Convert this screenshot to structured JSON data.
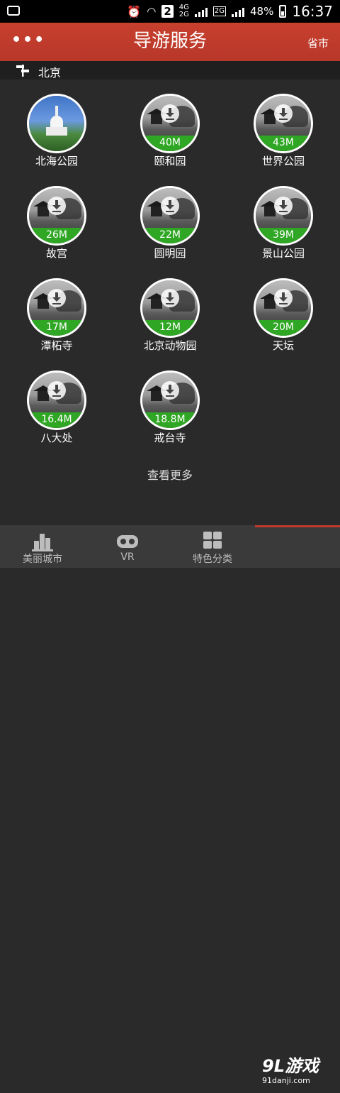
{
  "status_bar": {
    "sim_badge": "2",
    "net_4g": "4G",
    "net_2g": "2G",
    "net_2g_box": "2G",
    "battery": "48%",
    "time": "16:37"
  },
  "header": {
    "menu_glyph": "•••",
    "title": "导游服务",
    "right_label": "省市"
  },
  "city": {
    "name": "北京",
    "icon": "signpost-icon"
  },
  "spots": [
    {
      "name": "北海公园",
      "size": "",
      "downloaded": true
    },
    {
      "name": "颐和园",
      "size": "40M",
      "downloaded": false
    },
    {
      "name": "世界公园",
      "size": "43M",
      "downloaded": false
    },
    {
      "name": "故宫",
      "size": "26M",
      "downloaded": false
    },
    {
      "name": "圆明园",
      "size": "22M",
      "downloaded": false
    },
    {
      "name": "景山公园",
      "size": "39M",
      "downloaded": false
    },
    {
      "name": "潭柘寺",
      "size": "17M",
      "downloaded": false
    },
    {
      "name": "北京动物园",
      "size": "12M",
      "downloaded": false
    },
    {
      "name": "天坛",
      "size": "20M",
      "downloaded": false
    },
    {
      "name": "八大处",
      "size": "16.4M",
      "downloaded": false
    },
    {
      "name": "戒台寺",
      "size": "18.8M",
      "downloaded": false
    }
  ],
  "more_label": "查看更多",
  "tabs": [
    {
      "label": "美丽城市",
      "icon": "city-icon"
    },
    {
      "label": "VR",
      "icon": "vr-goggles-icon"
    },
    {
      "label": "特色分类",
      "icon": "category-grid-icon"
    }
  ],
  "watermark": {
    "logo": "9L游戏",
    "site": "91danji.com"
  },
  "colors": {
    "header": "#c0392b",
    "size_bar": "#2fa624",
    "background": "#2a2a2a"
  }
}
